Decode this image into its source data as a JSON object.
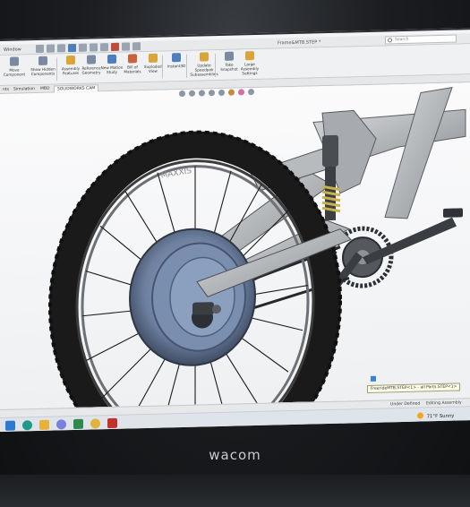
{
  "quick_access": {
    "menu_window": "Window",
    "doc_title": "Frame&MTB.STEP *",
    "search_placeholder": "Search"
  },
  "ribbon": {
    "buttons": [
      "Move Component",
      "Show Hidden Components",
      "Assembly Features",
      "Reference Geometry",
      "New Motion Study",
      "Bill of Materials",
      "Exploded View",
      "Instant3D",
      "Update Speedpak Subassemblies",
      "Take Snapshot",
      "Large Assembly Settings"
    ]
  },
  "tabs": {
    "items": [
      "nts",
      "Simulation",
      "MBD",
      "SOLIDWORKS CAM"
    ]
  },
  "viewport": {
    "tooltip": "FreerideMTB.STEP<1> - all Parts.STEP<1>",
    "tire_brand": "MAXXIS"
  },
  "statusbar": {
    "state": "Under Defined",
    "mode": "Editing Assembly"
  },
  "taskbar": {
    "weather_temp": "71°F",
    "weather_desc": "Sunny"
  },
  "bezel": {
    "brand": "wacom"
  },
  "colors": {
    "tire": "#1a1a1a",
    "frame": "#b9bcbf",
    "hub_motor": "#6c7f9f",
    "shock_spring": "#c9b24a"
  }
}
